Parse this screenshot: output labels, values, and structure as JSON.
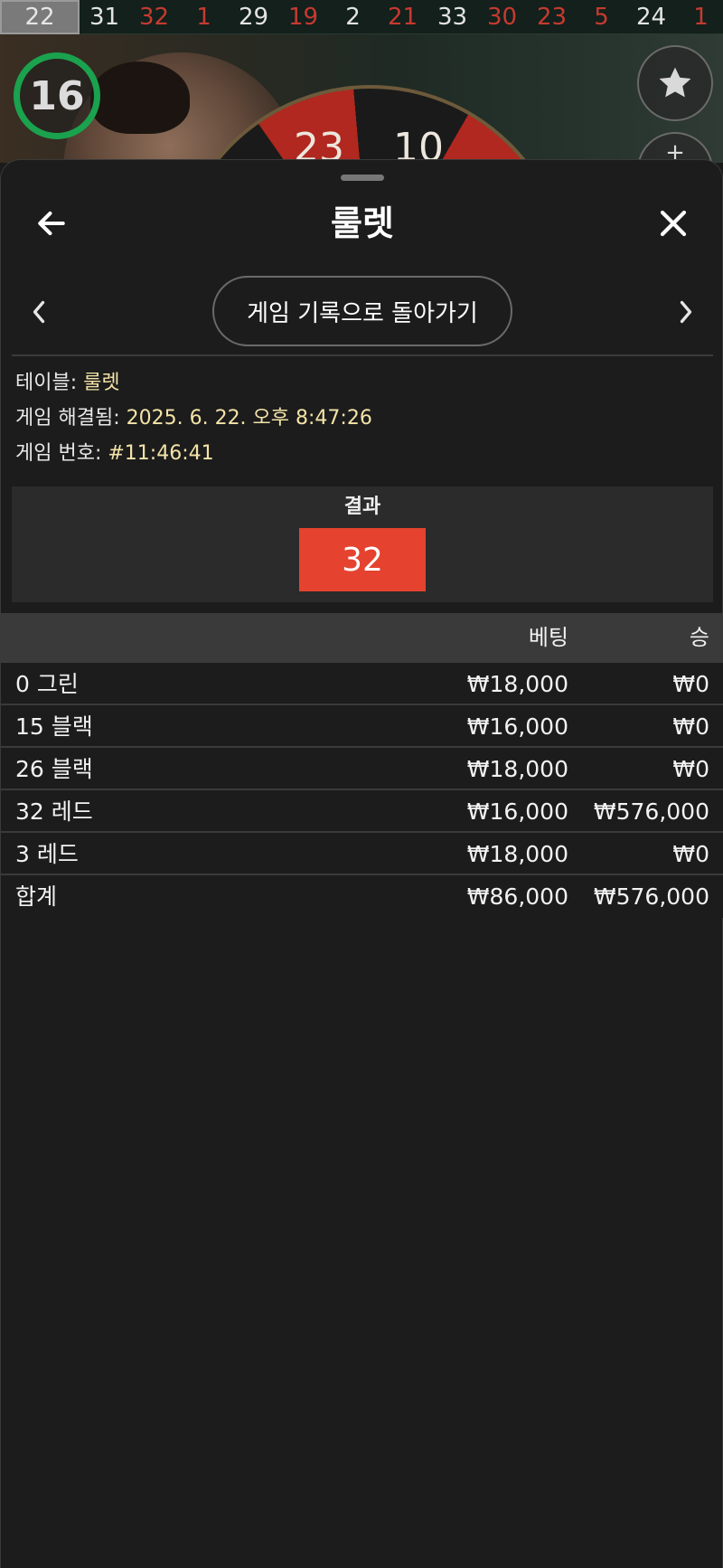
{
  "history": [
    {
      "n": "22",
      "c": "first"
    },
    {
      "n": "31",
      "c": "white"
    },
    {
      "n": "32",
      "c": "red"
    },
    {
      "n": "1",
      "c": "red"
    },
    {
      "n": "29",
      "c": "white"
    },
    {
      "n": "19",
      "c": "red"
    },
    {
      "n": "2",
      "c": "white"
    },
    {
      "n": "21",
      "c": "red"
    },
    {
      "n": "33",
      "c": "white"
    },
    {
      "n": "30",
      "c": "red"
    },
    {
      "n": "23",
      "c": "red"
    },
    {
      "n": "5",
      "c": "red"
    },
    {
      "n": "24",
      "c": "white"
    },
    {
      "n": "1",
      "c": "red"
    }
  ],
  "video": {
    "timer": "16",
    "wheel_numbers": [
      "23",
      "10"
    ]
  },
  "sheet": {
    "title": "룰렛",
    "back_button_label": "게임 기록으로 돌아가기",
    "info": {
      "table_label": "테이블: ",
      "table_value": "룰렛",
      "resolved_label": "게임 해결됨: ",
      "resolved_value": "2025. 6. 22. 오후 8:47:26",
      "game_no_label": "게임 번호: ",
      "game_no_value": "#11:46:41"
    },
    "result": {
      "label": "결과",
      "value": "32",
      "color": "#e5432f"
    },
    "table": {
      "headers": {
        "bet": "베팅",
        "win": "승"
      },
      "rows": [
        {
          "name": "0 그린",
          "bet": "₩18,000",
          "win": "₩0"
        },
        {
          "name": "15 블랙",
          "bet": "₩16,000",
          "win": "₩0"
        },
        {
          "name": "26 블랙",
          "bet": "₩18,000",
          "win": "₩0"
        },
        {
          "name": "32 레드",
          "bet": "₩16,000",
          "win": "₩576,000"
        },
        {
          "name": "3 레드",
          "bet": "₩18,000",
          "win": "₩0"
        }
      ],
      "total": {
        "name": "합계",
        "bet": "₩86,000",
        "win": "₩576,000"
      }
    }
  },
  "icons": {
    "back": "arrow-left-icon",
    "close": "close-icon",
    "prev": "chevron-left-icon",
    "next": "chevron-right-icon",
    "favorite": "star-icon"
  }
}
